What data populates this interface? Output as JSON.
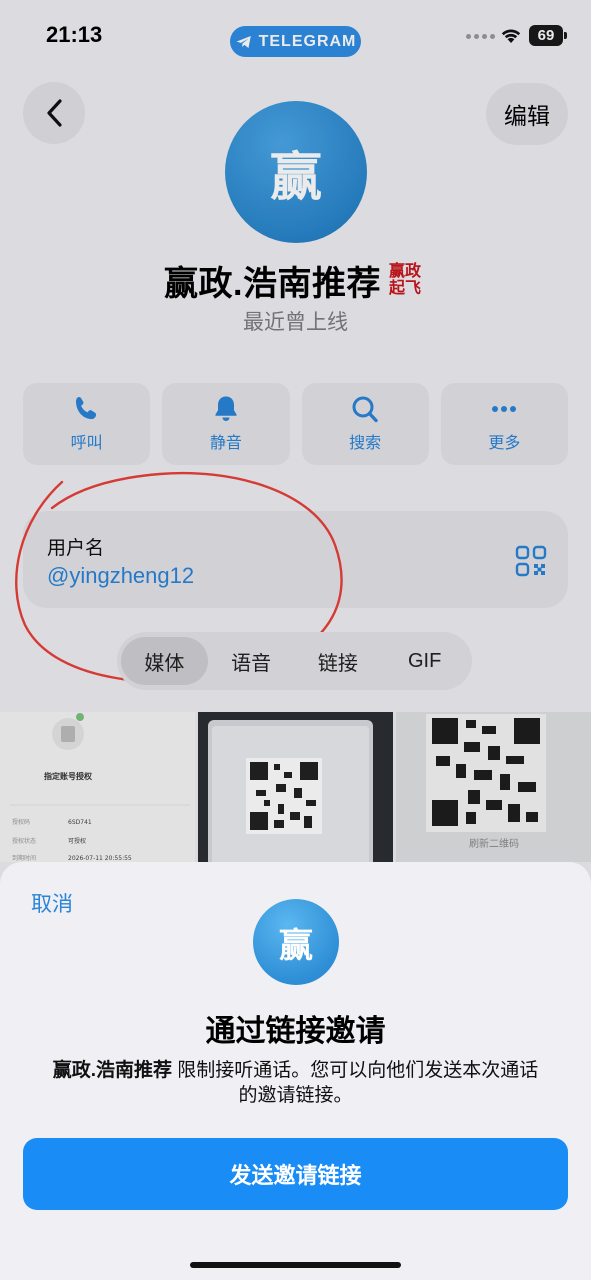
{
  "status_bar": {
    "time": "21:13",
    "app_pill": "TELEGRAM",
    "battery": "69"
  },
  "header": {
    "edit_label": "编辑"
  },
  "profile": {
    "avatar_char": "赢",
    "name": "赢政.浩南推荐",
    "badge_line1": "赢政",
    "badge_line2": "起飞",
    "status": "最近曾上线"
  },
  "actions": [
    {
      "label": "呼叫",
      "icon": "phone-icon"
    },
    {
      "label": "静音",
      "icon": "bell-icon"
    },
    {
      "label": "搜索",
      "icon": "search-icon"
    },
    {
      "label": "更多",
      "icon": "more-icon"
    }
  ],
  "username_card": {
    "label": "用户名",
    "value": "@yingzheng12"
  },
  "tabs": [
    {
      "label": "媒体",
      "active": true
    },
    {
      "label": "语音",
      "active": false
    },
    {
      "label": "链接",
      "active": false
    },
    {
      "label": "GIF",
      "active": false
    }
  ],
  "media_thumbs": {
    "thumb1": {
      "title": "指定账号授权",
      "rows": [
        {
          "k": "授权码",
          "v": "6SD741"
        },
        {
          "k": "授权状态",
          "v": "可授权"
        },
        {
          "k": "到期时间",
          "v": "2026-07-11 20:55:55"
        }
      ]
    },
    "thumb3": {
      "caption": "刷新二维码"
    }
  },
  "sheet": {
    "cancel_label": "取消",
    "avatar_char": "赢",
    "title": "通过链接邀请",
    "desc_name": "赢政.浩南推荐",
    "desc_rest": " 限制接听通话。您可以向他们发送本次通话的邀请链接。",
    "send_label": "发送邀请链接"
  },
  "colors": {
    "accent": "#2a84d8",
    "button": "#1a8cf6",
    "stamp_red": "#c8161c",
    "annotation": "#e8403a"
  }
}
